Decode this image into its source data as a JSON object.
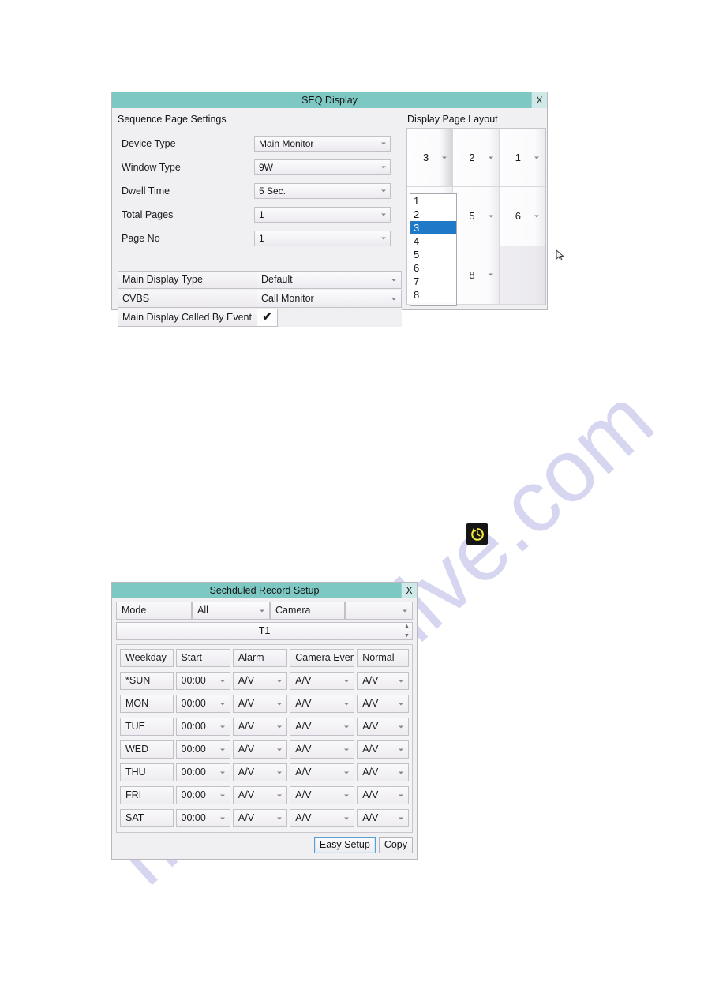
{
  "watermark": {
    "text": "manualshive.com",
    "color": "#c9c7ec"
  },
  "seq_dialog": {
    "title": "SEQ Display",
    "close_label": "X",
    "left_section_label": "Sequence Page Settings",
    "right_section_label": "Display Page Layout",
    "form_rows": [
      {
        "label": "Device Type",
        "value": "Main Monitor"
      },
      {
        "label": "Window Type",
        "value": "9W"
      },
      {
        "label": "Dwell Time",
        "value": "5 Sec."
      },
      {
        "label": "Total Pages",
        "value": "1"
      },
      {
        "label": "Page No",
        "value": "1"
      }
    ],
    "boxed_rows": [
      {
        "label": "Main Display Type",
        "value": "Default"
      },
      {
        "label": "CVBS",
        "value": "Call Monitor"
      }
    ],
    "checkbox_row": {
      "label": "Main Display Called By Event",
      "checked_glyph": "✔"
    },
    "layout_grid": {
      "cells": [
        "3",
        "2",
        "1",
        "",
        "5",
        "6",
        "",
        "8",
        ""
      ],
      "empty_indices": [
        3,
        6,
        8
      ]
    },
    "layout_dropdown": {
      "options": [
        "1",
        "2",
        "3",
        "4",
        "5",
        "6",
        "7",
        "8"
      ],
      "selected": "3",
      "selected_color": "#2079c8"
    },
    "cursor_icon": "mouse-pointer-icon"
  },
  "refresh_icon": {
    "name": "sequence-refresh-icon",
    "glyph_color": "#f5e93c",
    "background": "#151515"
  },
  "sched_dialog": {
    "title": "Sechduled Record Setup",
    "close_label": "X",
    "mode_row": {
      "mode_label": "Mode",
      "mode_value": "All",
      "camera_label": "Camera",
      "camera_value": ""
    },
    "timeline_label": "T1",
    "table": {
      "headers": [
        "Weekday",
        "Start",
        "Alarm",
        "Camera Event",
        "Normal"
      ],
      "rows": [
        {
          "weekday": "*SUN",
          "start": "00:00",
          "alarm": "A/V",
          "camera_event": "A/V",
          "normal": "A/V"
        },
        {
          "weekday": "MON",
          "start": "00:00",
          "alarm": "A/V",
          "camera_event": "A/V",
          "normal": "A/V"
        },
        {
          "weekday": "TUE",
          "start": "00:00",
          "alarm": "A/V",
          "camera_event": "A/V",
          "normal": "A/V"
        },
        {
          "weekday": "WED",
          "start": "00:00",
          "alarm": "A/V",
          "camera_event": "A/V",
          "normal": "A/V"
        },
        {
          "weekday": "THU",
          "start": "00:00",
          "alarm": "A/V",
          "camera_event": "A/V",
          "normal": "A/V"
        },
        {
          "weekday": "FRI",
          "start": "00:00",
          "alarm": "A/V",
          "camera_event": "A/V",
          "normal": "A/V"
        },
        {
          "weekday": "SAT",
          "start": "00:00",
          "alarm": "A/V",
          "camera_event": "A/V",
          "normal": "A/V"
        }
      ]
    },
    "buttons": {
      "easy_setup": "Easy Setup",
      "copy": "Copy"
    }
  },
  "theme": {
    "titlebar": "#7ec8c4",
    "dialog_bg": "#f0eff1",
    "highlight": "#2079c8"
  }
}
